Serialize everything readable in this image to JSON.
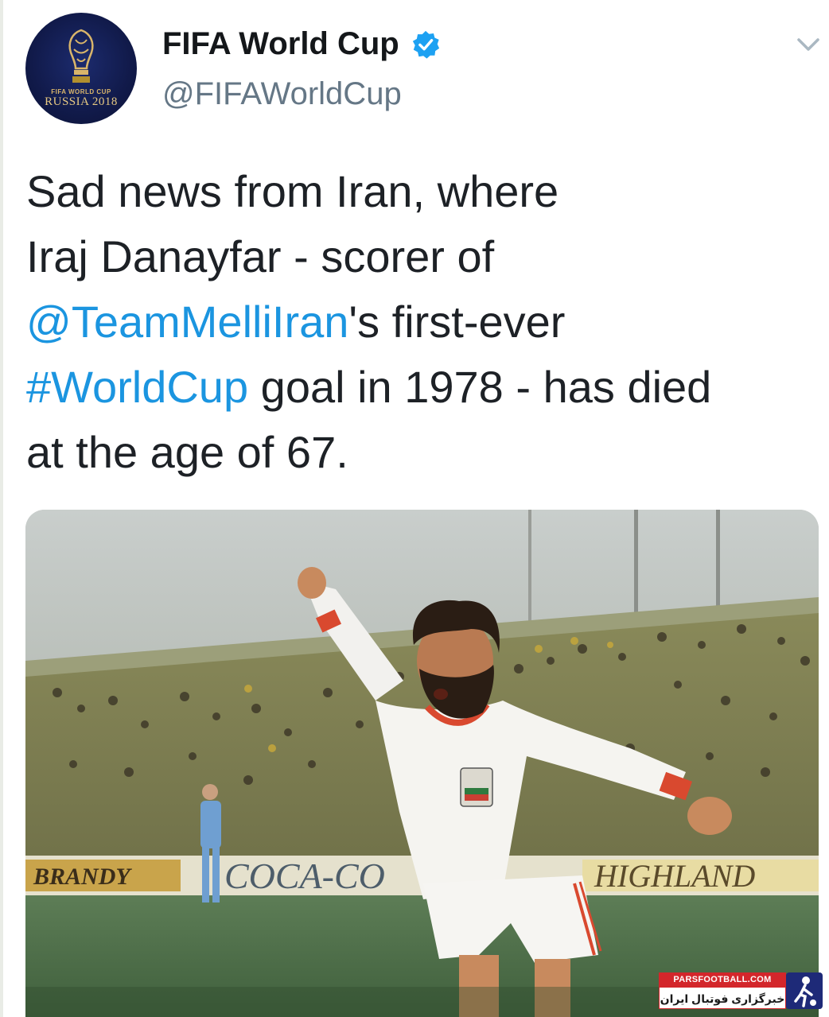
{
  "account": {
    "display_name": "FIFA World Cup",
    "handle": "@FIFAWorldCup",
    "verified": true,
    "avatar_badge_small": "FIFA WORLD CUP",
    "avatar_badge_large": "RUSSIA 2018",
    "verified_icon": "verified-badge-icon",
    "menu_icon": "chevron-down-icon"
  },
  "tweet": {
    "lines": [
      [
        {
          "text": "Sad news from Iran, where",
          "type": "text"
        }
      ],
      [
        {
          "text": "Iraj Danayfar - scorer of",
          "type": "text"
        }
      ],
      [
        {
          "text": "@TeamMelliIran",
          "type": "mention"
        },
        {
          "text": "'s first-ever",
          "type": "text"
        }
      ],
      [
        {
          "text": "#WorldCup",
          "type": "hashtag"
        },
        {
          "text": " goal in 1978 - has died",
          "type": "text"
        }
      ],
      [
        {
          "text": "at the age of 67.",
          "type": "text"
        }
      ]
    ]
  },
  "photo": {
    "ad_boards": [
      "BRANDY",
      "COCA-CO",
      "HIGHLAND"
    ]
  },
  "watermark": {
    "top": "PARSFOOTBALL.COM",
    "bottom": "خبرگزاری فوتبال ایران"
  },
  "colors": {
    "link": "#1b95e0",
    "text": "#1d2126",
    "handle": "#657786",
    "verified": "#1da1f2"
  }
}
